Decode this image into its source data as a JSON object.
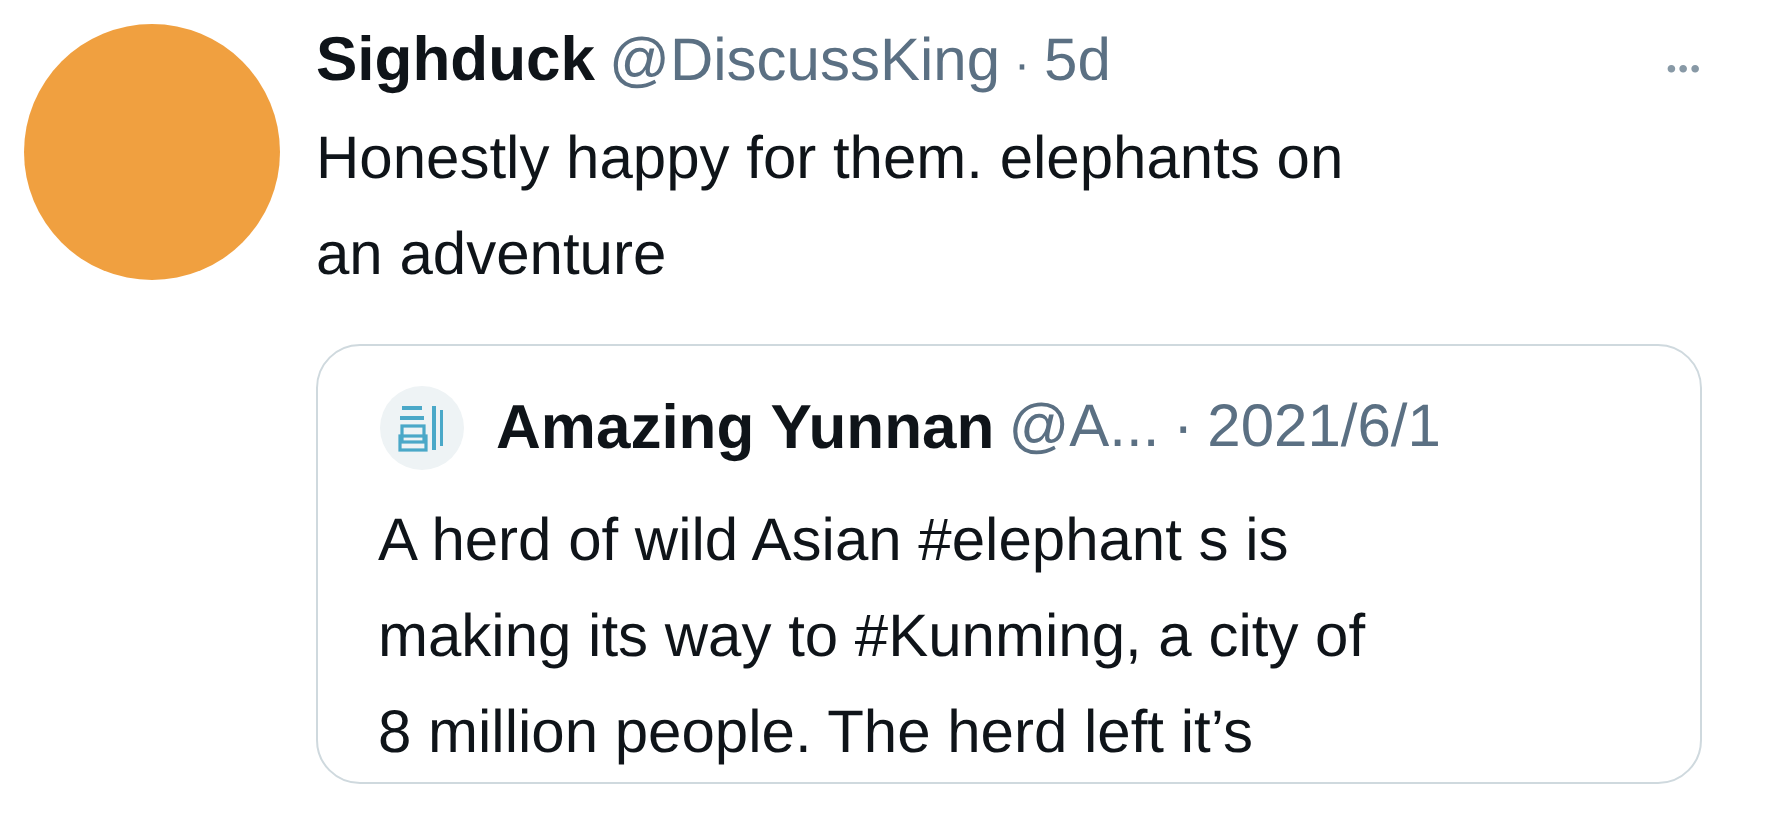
{
  "tweet": {
    "name": "Sighduck",
    "handle": "@DiscussKing",
    "separator": "·",
    "time": "5d",
    "more": "•••",
    "text": "Honestly happy for them. elephants on\nan adventure"
  },
  "quote": {
    "name": "Amazing Yunnan",
    "handle": "@A...",
    "separator": "·",
    "time": "2021/6/1",
    "text": "A herd of wild Asian #elephant s is\nmaking its way to #Kunming, a city of\n8 million people. The herd left it’s"
  }
}
